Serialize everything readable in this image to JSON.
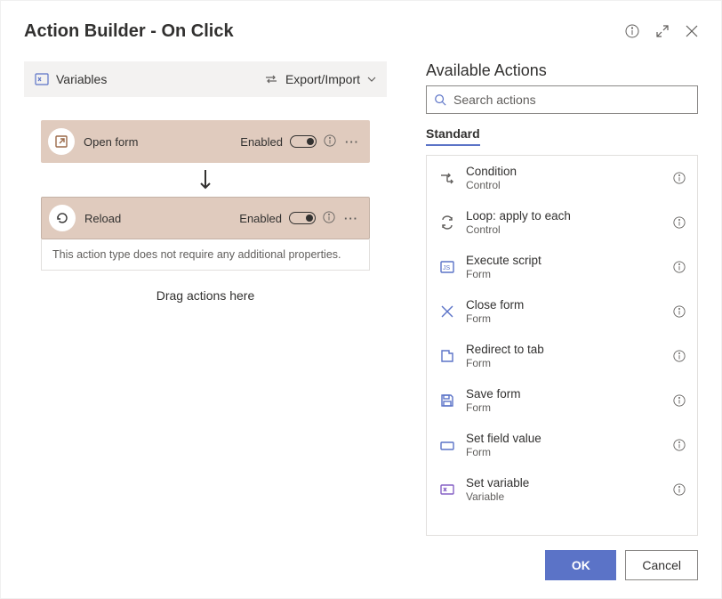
{
  "header": {
    "title": "Action Builder - On Click"
  },
  "toolbar": {
    "variables_label": "Variables",
    "export_import_label": "Export/Import"
  },
  "flow": {
    "items": [
      {
        "title": "Open form",
        "status": "Enabled"
      },
      {
        "title": "Reload",
        "status": "Enabled"
      }
    ],
    "detail_text": "This action type does not require any additional properties.",
    "drop_hint": "Drag actions here"
  },
  "right": {
    "title": "Available Actions",
    "search_placeholder": "Search actions",
    "tab_label": "Standard",
    "actions": [
      {
        "name": "Condition",
        "category": "Control",
        "icon": "condition"
      },
      {
        "name": "Loop: apply to each",
        "category": "Control",
        "icon": "loop"
      },
      {
        "name": "Execute script",
        "category": "Form",
        "icon": "script"
      },
      {
        "name": "Close form",
        "category": "Form",
        "icon": "close"
      },
      {
        "name": "Redirect to tab",
        "category": "Form",
        "icon": "tab"
      },
      {
        "name": "Save form",
        "category": "Form",
        "icon": "save"
      },
      {
        "name": "Set field value",
        "category": "Form",
        "icon": "field"
      },
      {
        "name": "Set variable",
        "category": "Variable",
        "icon": "variable"
      }
    ]
  },
  "footer": {
    "ok_label": "OK",
    "cancel_label": "Cancel"
  }
}
